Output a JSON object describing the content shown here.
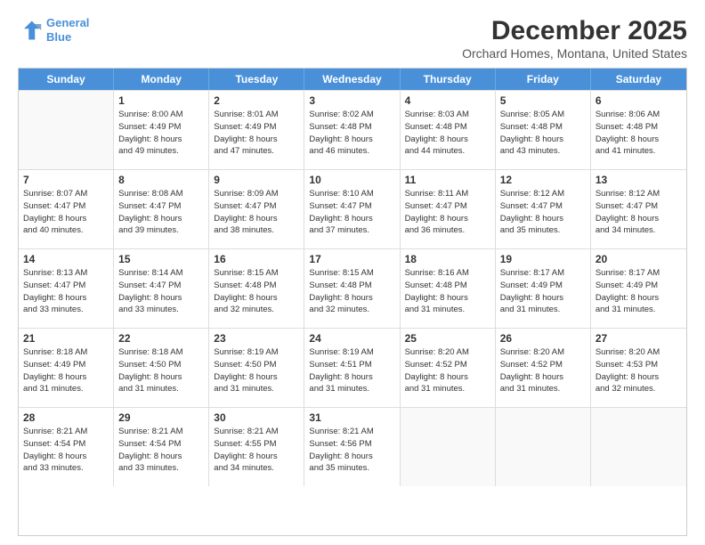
{
  "header": {
    "logo_line1": "General",
    "logo_line2": "Blue",
    "title": "December 2025",
    "subtitle": "Orchard Homes, Montana, United States"
  },
  "weekdays": [
    "Sunday",
    "Monday",
    "Tuesday",
    "Wednesday",
    "Thursday",
    "Friday",
    "Saturday"
  ],
  "weeks": [
    [
      {
        "day": "",
        "info": ""
      },
      {
        "day": "1",
        "info": "Sunrise: 8:00 AM\nSunset: 4:49 PM\nDaylight: 8 hours\nand 49 minutes."
      },
      {
        "day": "2",
        "info": "Sunrise: 8:01 AM\nSunset: 4:49 PM\nDaylight: 8 hours\nand 47 minutes."
      },
      {
        "day": "3",
        "info": "Sunrise: 8:02 AM\nSunset: 4:48 PM\nDaylight: 8 hours\nand 46 minutes."
      },
      {
        "day": "4",
        "info": "Sunrise: 8:03 AM\nSunset: 4:48 PM\nDaylight: 8 hours\nand 44 minutes."
      },
      {
        "day": "5",
        "info": "Sunrise: 8:05 AM\nSunset: 4:48 PM\nDaylight: 8 hours\nand 43 minutes."
      },
      {
        "day": "6",
        "info": "Sunrise: 8:06 AM\nSunset: 4:48 PM\nDaylight: 8 hours\nand 41 minutes."
      }
    ],
    [
      {
        "day": "7",
        "info": "Sunrise: 8:07 AM\nSunset: 4:47 PM\nDaylight: 8 hours\nand 40 minutes."
      },
      {
        "day": "8",
        "info": "Sunrise: 8:08 AM\nSunset: 4:47 PM\nDaylight: 8 hours\nand 39 minutes."
      },
      {
        "day": "9",
        "info": "Sunrise: 8:09 AM\nSunset: 4:47 PM\nDaylight: 8 hours\nand 38 minutes."
      },
      {
        "day": "10",
        "info": "Sunrise: 8:10 AM\nSunset: 4:47 PM\nDaylight: 8 hours\nand 37 minutes."
      },
      {
        "day": "11",
        "info": "Sunrise: 8:11 AM\nSunset: 4:47 PM\nDaylight: 8 hours\nand 36 minutes."
      },
      {
        "day": "12",
        "info": "Sunrise: 8:12 AM\nSunset: 4:47 PM\nDaylight: 8 hours\nand 35 minutes."
      },
      {
        "day": "13",
        "info": "Sunrise: 8:12 AM\nSunset: 4:47 PM\nDaylight: 8 hours\nand 34 minutes."
      }
    ],
    [
      {
        "day": "14",
        "info": "Sunrise: 8:13 AM\nSunset: 4:47 PM\nDaylight: 8 hours\nand 33 minutes."
      },
      {
        "day": "15",
        "info": "Sunrise: 8:14 AM\nSunset: 4:47 PM\nDaylight: 8 hours\nand 33 minutes."
      },
      {
        "day": "16",
        "info": "Sunrise: 8:15 AM\nSunset: 4:48 PM\nDaylight: 8 hours\nand 32 minutes."
      },
      {
        "day": "17",
        "info": "Sunrise: 8:15 AM\nSunset: 4:48 PM\nDaylight: 8 hours\nand 32 minutes."
      },
      {
        "day": "18",
        "info": "Sunrise: 8:16 AM\nSunset: 4:48 PM\nDaylight: 8 hours\nand 31 minutes."
      },
      {
        "day": "19",
        "info": "Sunrise: 8:17 AM\nSunset: 4:49 PM\nDaylight: 8 hours\nand 31 minutes."
      },
      {
        "day": "20",
        "info": "Sunrise: 8:17 AM\nSunset: 4:49 PM\nDaylight: 8 hours\nand 31 minutes."
      }
    ],
    [
      {
        "day": "21",
        "info": "Sunrise: 8:18 AM\nSunset: 4:49 PM\nDaylight: 8 hours\nand 31 minutes."
      },
      {
        "day": "22",
        "info": "Sunrise: 8:18 AM\nSunset: 4:50 PM\nDaylight: 8 hours\nand 31 minutes."
      },
      {
        "day": "23",
        "info": "Sunrise: 8:19 AM\nSunset: 4:50 PM\nDaylight: 8 hours\nand 31 minutes."
      },
      {
        "day": "24",
        "info": "Sunrise: 8:19 AM\nSunset: 4:51 PM\nDaylight: 8 hours\nand 31 minutes."
      },
      {
        "day": "25",
        "info": "Sunrise: 8:20 AM\nSunset: 4:52 PM\nDaylight: 8 hours\nand 31 minutes."
      },
      {
        "day": "26",
        "info": "Sunrise: 8:20 AM\nSunset: 4:52 PM\nDaylight: 8 hours\nand 31 minutes."
      },
      {
        "day": "27",
        "info": "Sunrise: 8:20 AM\nSunset: 4:53 PM\nDaylight: 8 hours\nand 32 minutes."
      }
    ],
    [
      {
        "day": "28",
        "info": "Sunrise: 8:21 AM\nSunset: 4:54 PM\nDaylight: 8 hours\nand 33 minutes."
      },
      {
        "day": "29",
        "info": "Sunrise: 8:21 AM\nSunset: 4:54 PM\nDaylight: 8 hours\nand 33 minutes."
      },
      {
        "day": "30",
        "info": "Sunrise: 8:21 AM\nSunset: 4:55 PM\nDaylight: 8 hours\nand 34 minutes."
      },
      {
        "day": "31",
        "info": "Sunrise: 8:21 AM\nSunset: 4:56 PM\nDaylight: 8 hours\nand 35 minutes."
      },
      {
        "day": "",
        "info": ""
      },
      {
        "day": "",
        "info": ""
      },
      {
        "day": "",
        "info": ""
      }
    ]
  ]
}
